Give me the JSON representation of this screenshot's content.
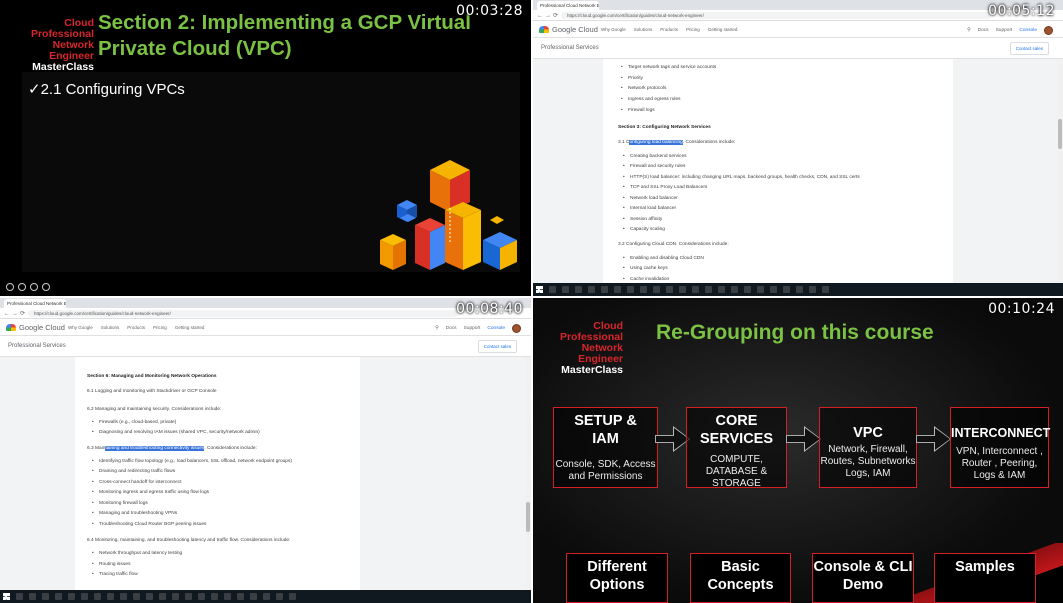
{
  "q1": {
    "timestamp": "00:03:28",
    "brand": {
      "line1": "Cloud Professional",
      "line2": "Network Engineer",
      "line3": "MasterClass"
    },
    "title": "Section 2: Implementing a GCP Virtual Private Cloud (VPC)",
    "bullet": "✓2.1 Configuring VPCs"
  },
  "q2": {
    "timestamp": "00:05:12",
    "tab_title": "Professional Cloud Network Eng",
    "url": "https://cloud.google.com/certification/guides/cloud-network-engineer/",
    "logo": "Google Cloud",
    "nav": [
      "Why Google",
      "Solutions",
      "Products",
      "Pricing",
      "Getting started"
    ],
    "right": {
      "docs": "Docs",
      "support": "Support",
      "console": "Console"
    },
    "section_label": "Professional Services",
    "contact": "Contact sales",
    "lines": [
      {
        "t": "Target network tags and service accounts",
        "k": "li"
      },
      {
        "t": "Priority",
        "k": "li"
      },
      {
        "t": "Network protocols",
        "k": "li"
      },
      {
        "t": "Ingress and egress rules",
        "k": "li"
      },
      {
        "t": "Firewall logs",
        "k": "li"
      },
      {
        "t": "Section 3: Configuring Network Services",
        "k": "hd"
      },
      {
        "t": "Creating backend services",
        "k": "li"
      },
      {
        "t": "Firewall and security rules",
        "k": "li"
      },
      {
        "t": "HTTP(S) load balancer: including changing URL maps, backend groups, health checks, CDN, and SSL certs",
        "k": "li"
      },
      {
        "t": "TCP and SSL Proxy Load Balancers",
        "k": "li"
      },
      {
        "t": "Network load balancer",
        "k": "li"
      },
      {
        "t": "Internal load balancer",
        "k": "li"
      },
      {
        "t": "Session affinity",
        "k": "li"
      },
      {
        "t": "Capacity scaling",
        "k": "li"
      },
      {
        "t": "3.2 Configuring Cloud CDN. Considerations include:",
        "k": "p"
      },
      {
        "t": "Enabling and disabling Cloud CDN",
        "k": "li"
      },
      {
        "t": "Using cache keys",
        "k": "li"
      },
      {
        "t": "Cache invalidation",
        "k": "li"
      }
    ],
    "hl_line": {
      "pre": "3.1 C",
      "hl": "onfiguring load balancing",
      "post": ". Considerations include:"
    }
  },
  "q3": {
    "timestamp": "00:08:40",
    "tab_title": "Professional Cloud Network Eng",
    "url": "https://cloud.google.com/certification/guides/cloud-network-engineer/",
    "logo": "Google Cloud",
    "nav": [
      "Why Google",
      "Solutions",
      "Products",
      "Pricing",
      "Getting started"
    ],
    "right": {
      "docs": "Docs",
      "support": "Support",
      "console": "Console"
    },
    "section_label": "Professional Services",
    "contact": "Contact sales",
    "lines": [
      {
        "t": "Section 6: Managing and Monitoring Network Operations",
        "k": "hd"
      },
      {
        "t": "6.1 Logging and monitoring with Stackdriver or GCP Console",
        "k": "p"
      },
      {
        "t": "6.2 Managing and maintaining security. Considerations include:",
        "k": "p"
      },
      {
        "t": "Firewalls (e.g., cloud-based, private)",
        "k": "li"
      },
      {
        "t": "Diagnosing and resolving IAM issues (shared VPC, security/network admin)",
        "k": "li"
      },
      {
        "t": "Identifying traffic flow topology (e.g., load balancers, SSL offload, network endpoint groups)",
        "k": "li"
      },
      {
        "t": "Draining and redirecting traffic flows",
        "k": "li"
      },
      {
        "t": "Cross-connect handoff for interconnect",
        "k": "li"
      },
      {
        "t": "Monitoring ingress and egress traffic using flow logs",
        "k": "li"
      },
      {
        "t": "Monitoring firewall logs",
        "k": "li"
      },
      {
        "t": "Managing and troubleshooting VPNs",
        "k": "li"
      },
      {
        "t": "Troubleshooting Cloud Router BGP peering issues",
        "k": "li"
      },
      {
        "t": "6.4 Monitoring, maintaining, and troubleshooting latency and traffic flow. Considerations include:",
        "k": "p"
      },
      {
        "t": "Network throughput and latency testing",
        "k": "li"
      },
      {
        "t": "Routing issues",
        "k": "li"
      },
      {
        "t": "Tracing traffic flow",
        "k": "li"
      }
    ],
    "hl_line": {
      "pre": "6.3 Main",
      "hl": "taining and troubleshooting connectivity issues",
      "post": ". Considerations include:"
    }
  },
  "q4": {
    "timestamp": "00:10:24",
    "brand": {
      "line1": "Cloud Professional",
      "line2": "Network Engineer",
      "line3": "MasterClass"
    },
    "title": "Re-Grouping on this course",
    "boxes": [
      {
        "h": "SETUP & IAM",
        "s": "Console, SDK, Access and Permissions"
      },
      {
        "h": "CORE SERVICES",
        "s": "COMPUTE, DATABASE & STORAGE"
      },
      {
        "h": "VPC",
        "s": "Network, Firewall, Routes, Subnetworks Logs, IAM"
      },
      {
        "h": "INTERCONNECT",
        "s": "VPN, Interconnect , Router , Peering, Logs & IAM"
      }
    ],
    "bottom": [
      "Different Options",
      "Basic Concepts",
      "Console & CLI Demo",
      "Samples"
    ]
  }
}
